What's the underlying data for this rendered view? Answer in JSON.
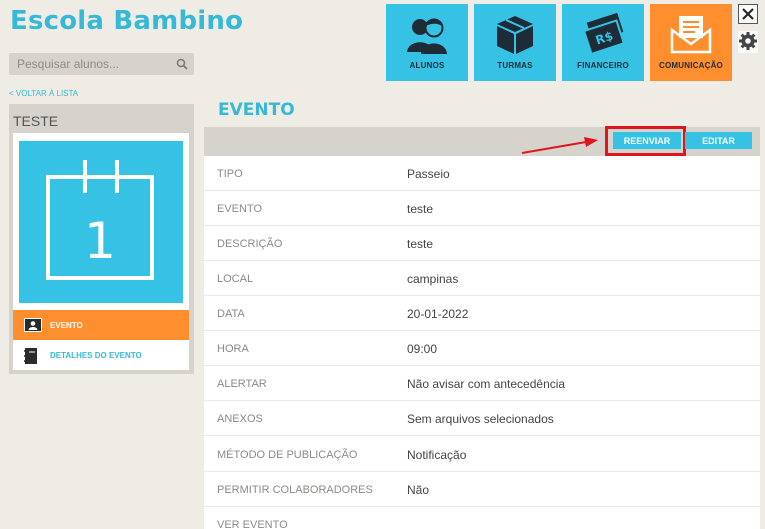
{
  "app": {
    "title": "Escola Bambino"
  },
  "search": {
    "placeholder": "Pesquisar alunos..."
  },
  "nav": [
    {
      "label": "ALUNOS",
      "icon": "students-icon",
      "active": false
    },
    {
      "label": "TURMAS",
      "icon": "box-icon",
      "active": false
    },
    {
      "label": "FINANCEIRO",
      "icon": "money-icon",
      "active": false
    },
    {
      "label": "COMUNICAÇÃO",
      "icon": "envelope-icon",
      "active": true
    }
  ],
  "back_link": "< VOLTAR À LISTA",
  "left_panel": {
    "title": "TESTE",
    "calendar_day": "1",
    "items": [
      {
        "label": "EVENTO",
        "icon": "id-card-icon",
        "active": true
      },
      {
        "label": "DETALHES DO EVENTO",
        "icon": "notebook-icon",
        "active": false
      }
    ]
  },
  "section_title": "EVENTO",
  "toolbar": {
    "resend_label": "REENVIAR",
    "edit_label": "EDITAR"
  },
  "details": [
    {
      "key": "TIPO",
      "value": "Passeio"
    },
    {
      "key": "EVENTO",
      "value": "teste"
    },
    {
      "key": "DESCRIÇÃO",
      "value": "teste"
    },
    {
      "key": "LOCAL",
      "value": "campinas"
    },
    {
      "key": "DATA",
      "value": "20-01-2022"
    },
    {
      "key": "HORA",
      "value": "09:00"
    },
    {
      "key": "ALERTAR",
      "value": "Não avisar com antecedência"
    },
    {
      "key": "ANEXOS",
      "value": "Sem arquivos selecionados"
    },
    {
      "key": "MÉTODO DE PUBLICAÇÃO",
      "value": "Notificação"
    },
    {
      "key": "PERMITIR COLABORADORES",
      "value": "Não"
    },
    {
      "key": "VER EVENTO",
      "value": ""
    }
  ],
  "colors": {
    "brand": "#35b9d6",
    "tile": "#35c2e4",
    "active": "#ff8f2e",
    "highlight": "#e0161c"
  }
}
